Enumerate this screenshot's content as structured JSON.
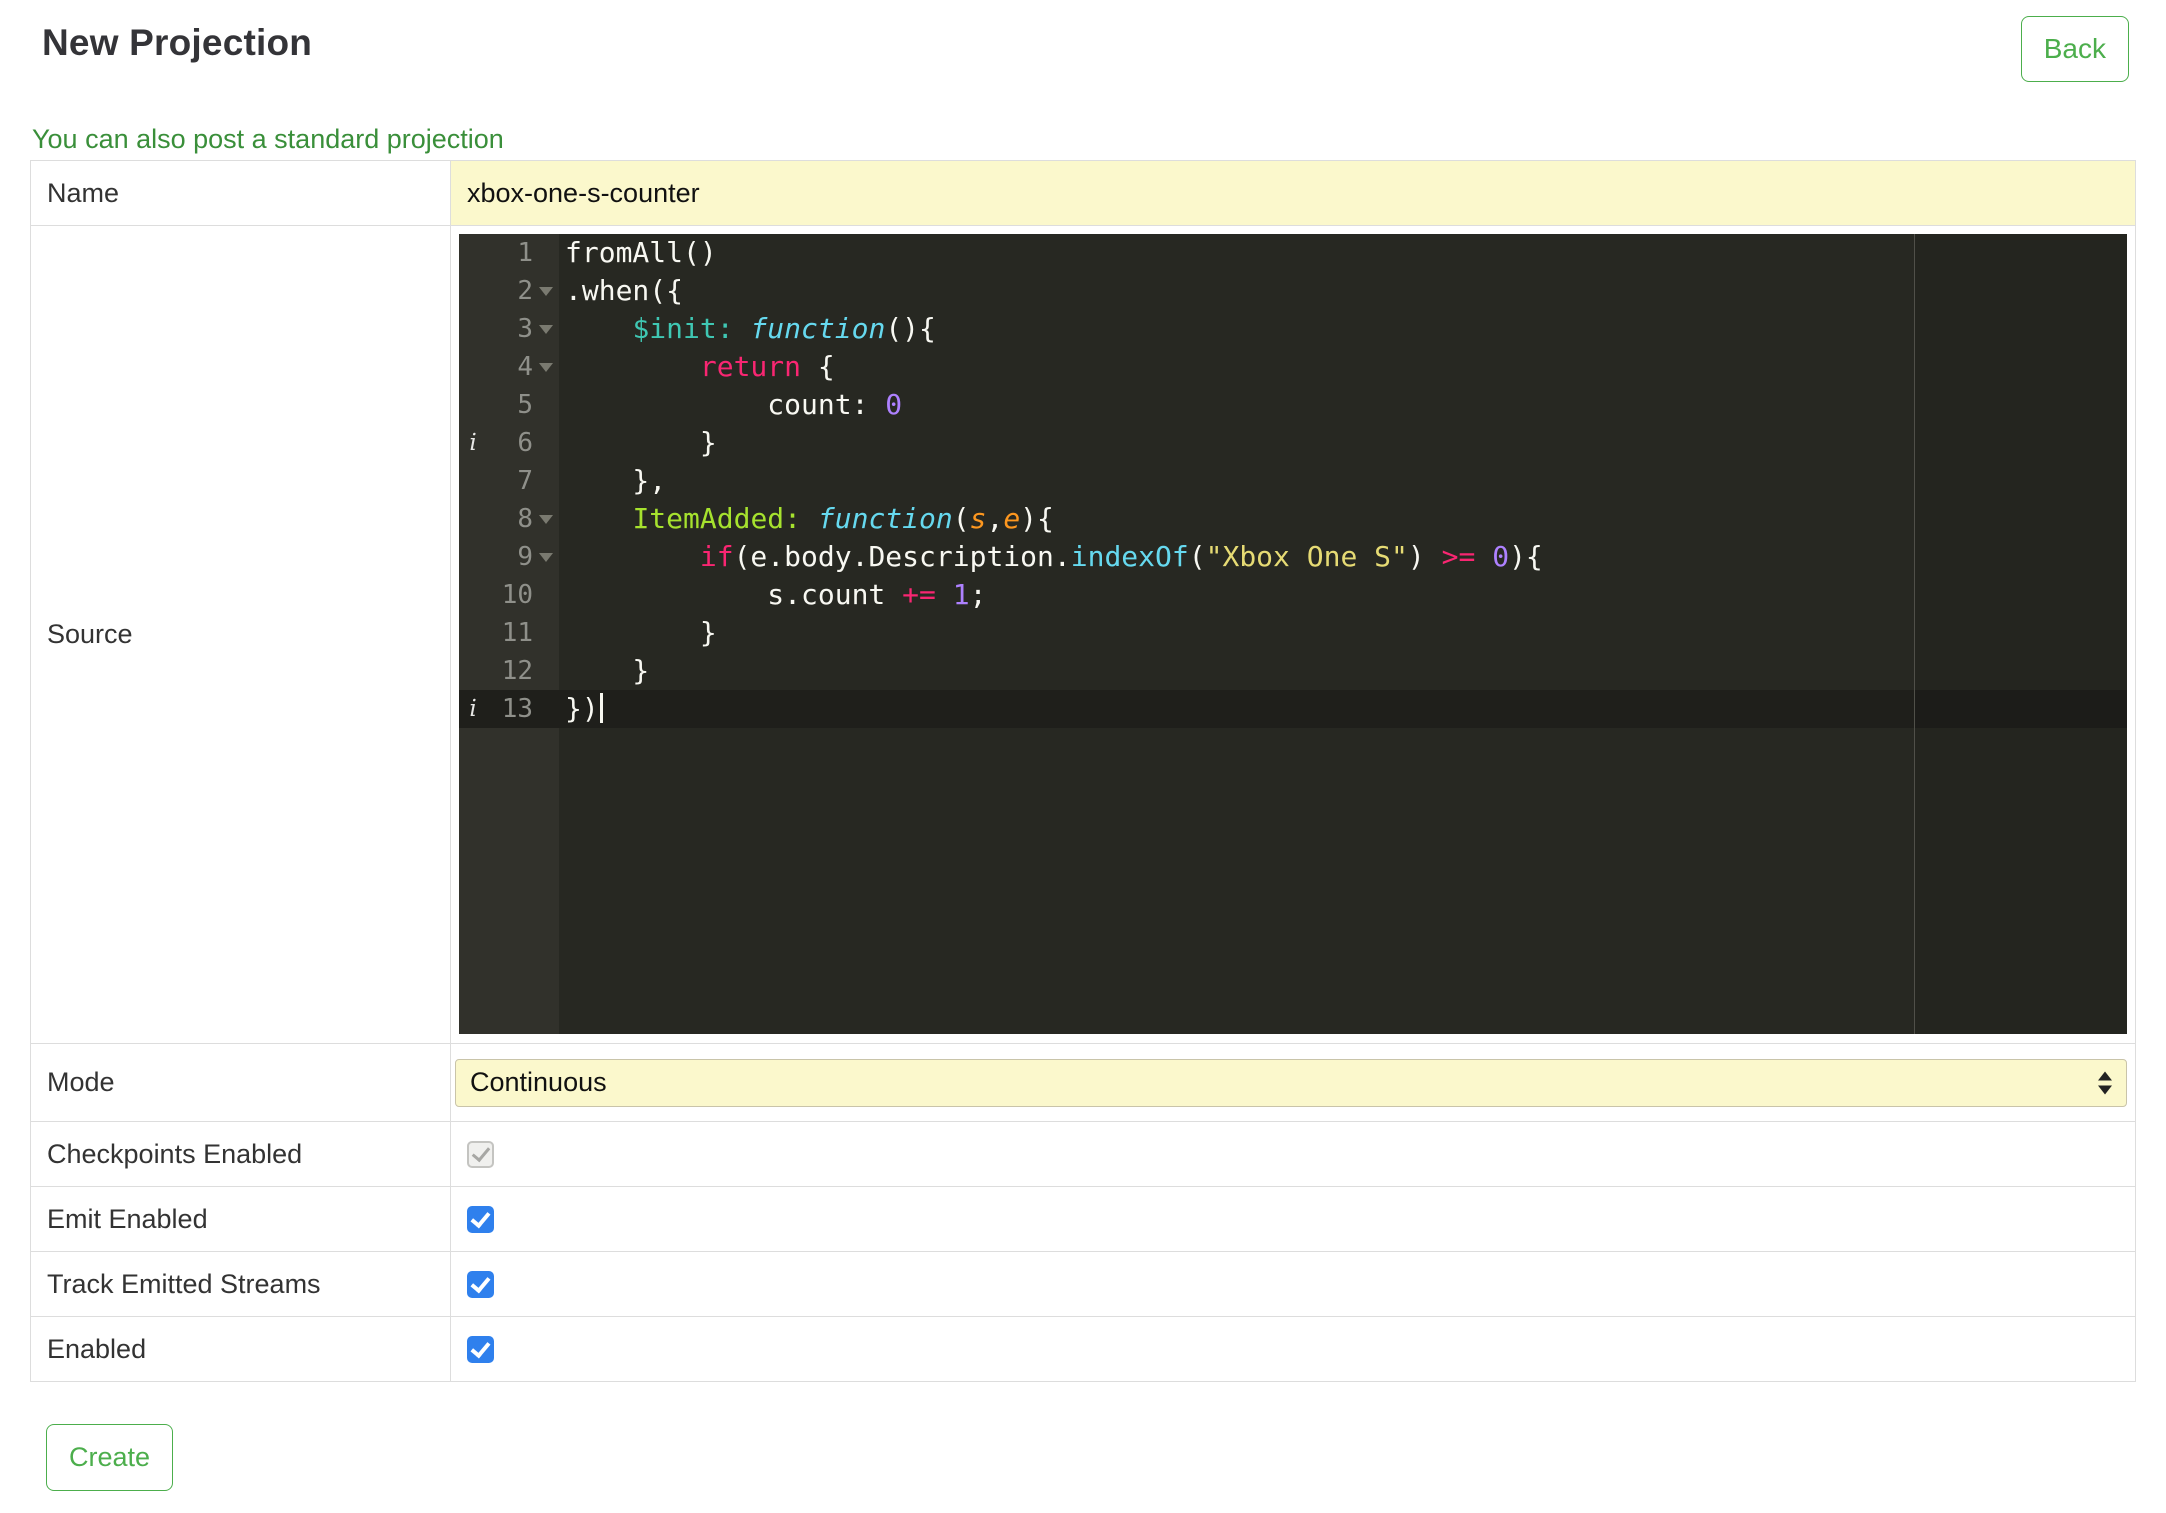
{
  "colors": {
    "accent_green": "#4cae4c",
    "link_green": "#3a8f3a",
    "field_yellow": "#fbf8cc",
    "editor_background": "#272822",
    "editor_gutter": "#31312b",
    "token_keyword": "#f92672",
    "token_function_keyword": "#66d9ef",
    "token_property": "#a6e22e",
    "token_string": "#e6db74",
    "token_number": "#ae81ff",
    "token_argument": "#fd971f",
    "token_init": "#3fc7b3",
    "checkbox_blue": "#2f80ed"
  },
  "header": {
    "title": "New Projection",
    "back_label": "Back"
  },
  "note_link": "You can also post a standard projection",
  "form": {
    "name": {
      "label": "Name",
      "value": "xbox-one-s-counter"
    },
    "source": {
      "label": "Source"
    },
    "mode": {
      "label": "Mode",
      "value": "Continuous"
    },
    "checkbox_rows": [
      {
        "label": "Checkpoints Enabled",
        "checked": true,
        "disabled": true
      },
      {
        "label": "Emit Enabled",
        "checked": true,
        "disabled": false
      },
      {
        "label": "Track Emitted Streams",
        "checked": true,
        "disabled": false
      },
      {
        "label": "Enabled",
        "checked": true,
        "disabled": false
      }
    ],
    "create_label": "Create"
  },
  "editor": {
    "lines": [
      {
        "no": "1",
        "fold": false,
        "info": false,
        "active": false,
        "cursor": false,
        "segs": [
          {
            "t": "fromAll()",
            "c": "plain"
          }
        ]
      },
      {
        "no": "2",
        "fold": true,
        "info": false,
        "active": false,
        "cursor": false,
        "segs": [
          {
            "t": ".when({",
            "c": "plain"
          }
        ]
      },
      {
        "no": "3",
        "fold": true,
        "info": false,
        "active": false,
        "cursor": false,
        "segs": [
          {
            "t": "    ",
            "c": "plain"
          },
          {
            "t": "$init:",
            "c": "init"
          },
          {
            "t": " ",
            "c": "plain"
          },
          {
            "t": "function",
            "c": "fnkw"
          },
          {
            "t": "(){",
            "c": "plain"
          }
        ]
      },
      {
        "no": "4",
        "fold": true,
        "info": false,
        "active": false,
        "cursor": false,
        "segs": [
          {
            "t": "        ",
            "c": "plain"
          },
          {
            "t": "return",
            "c": "kw"
          },
          {
            "t": " {",
            "c": "plain"
          }
        ]
      },
      {
        "no": "5",
        "fold": false,
        "info": false,
        "active": false,
        "cursor": false,
        "segs": [
          {
            "t": "            count: ",
            "c": "plain"
          },
          {
            "t": "0",
            "c": "num"
          }
        ]
      },
      {
        "no": "6",
        "fold": false,
        "info": true,
        "active": false,
        "cursor": false,
        "segs": [
          {
            "t": "        }",
            "c": "plain"
          }
        ]
      },
      {
        "no": "7",
        "fold": false,
        "info": false,
        "active": false,
        "cursor": false,
        "segs": [
          {
            "t": "    },",
            "c": "plain"
          }
        ]
      },
      {
        "no": "8",
        "fold": true,
        "info": false,
        "active": false,
        "cursor": false,
        "segs": [
          {
            "t": "    ",
            "c": "plain"
          },
          {
            "t": "ItemAdded:",
            "c": "prop"
          },
          {
            "t": " ",
            "c": "plain"
          },
          {
            "t": "function",
            "c": "fnkw"
          },
          {
            "t": "(",
            "c": "plain"
          },
          {
            "t": "s",
            "c": "arg"
          },
          {
            "t": ",",
            "c": "plain"
          },
          {
            "t": "e",
            "c": "arg"
          },
          {
            "t": "){",
            "c": "plain"
          }
        ]
      },
      {
        "no": "9",
        "fold": true,
        "info": false,
        "active": false,
        "cursor": false,
        "segs": [
          {
            "t": "        ",
            "c": "plain"
          },
          {
            "t": "if",
            "c": "kw"
          },
          {
            "t": "(e.body.Description.",
            "c": "plain"
          },
          {
            "t": "indexOf",
            "c": "builtin"
          },
          {
            "t": "(",
            "c": "plain"
          },
          {
            "t": "\"Xbox One S\"",
            "c": "str"
          },
          {
            "t": ") ",
            "c": "plain"
          },
          {
            "t": ">=",
            "c": "kw"
          },
          {
            "t": " ",
            "c": "plain"
          },
          {
            "t": "0",
            "c": "num"
          },
          {
            "t": "){",
            "c": "plain"
          }
        ]
      },
      {
        "no": "10",
        "fold": false,
        "info": false,
        "active": false,
        "cursor": false,
        "segs": [
          {
            "t": "            s.count ",
            "c": "plain"
          },
          {
            "t": "+=",
            "c": "kw"
          },
          {
            "t": " ",
            "c": "plain"
          },
          {
            "t": "1",
            "c": "num"
          },
          {
            "t": ";",
            "c": "plain"
          }
        ]
      },
      {
        "no": "11",
        "fold": false,
        "info": false,
        "active": false,
        "cursor": false,
        "segs": [
          {
            "t": "        }",
            "c": "plain"
          }
        ]
      },
      {
        "no": "12",
        "fold": false,
        "info": false,
        "active": false,
        "cursor": false,
        "segs": [
          {
            "t": "    }",
            "c": "plain"
          }
        ]
      },
      {
        "no": "13",
        "fold": false,
        "info": true,
        "active": true,
        "cursor": true,
        "segs": [
          {
            "t": "})",
            "c": "plain"
          }
        ]
      }
    ]
  }
}
